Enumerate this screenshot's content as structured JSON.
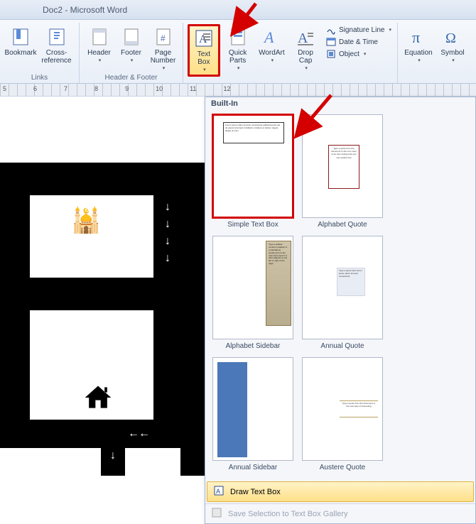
{
  "title": "Doc2 - Microsoft Word",
  "ribbon": {
    "links": {
      "bookmark": "Bookmark",
      "crossref": "Cross-reference",
      "group": "Links"
    },
    "hf": {
      "header": "Header",
      "footer": "Footer",
      "pagenum": "Page Number",
      "group": "Header & Footer"
    },
    "text": {
      "textbox": "Text Box",
      "quickparts": "Quick Parts",
      "wordart": "WordArt",
      "dropcap": "Drop Cap",
      "sigline": "Signature Line",
      "datetime": "Date & Time",
      "object": "Object"
    },
    "symbols": {
      "equation": "Equation",
      "symbol": "Symbol"
    }
  },
  "ruler": [
    "5",
    "6",
    "7",
    "8",
    "9",
    "10",
    "11",
    "12"
  ],
  "gallery": {
    "header": "Built-In",
    "items": [
      "Simple Text Box",
      "Alphabet Quote",
      "Alphabet Sidebar",
      "Annual Quote",
      "Annual Sidebar",
      "Austere Quote"
    ],
    "draw": "Draw Text Box",
    "save": "Save Selection to Text Box Gallery"
  }
}
